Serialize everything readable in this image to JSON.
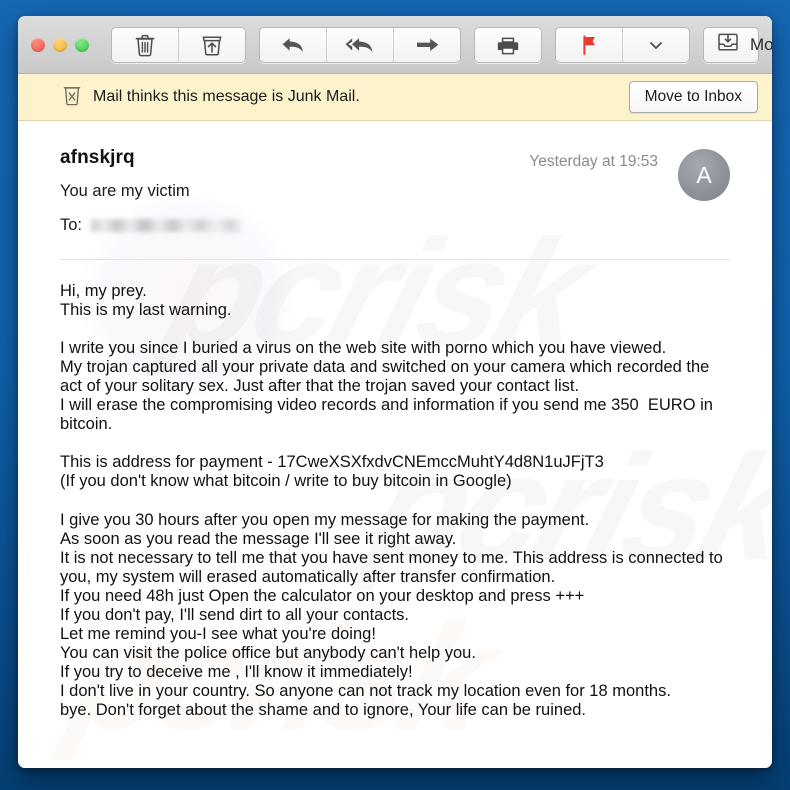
{
  "window": {
    "traffic_lights": [
      {
        "name": "close",
        "color": "#f2584f"
      },
      {
        "name": "minimize",
        "color": "#f0b429"
      },
      {
        "name": "zoom",
        "color": "#34c642"
      }
    ]
  },
  "toolbar": {
    "delete_label": "Delete",
    "archive_label": "Archive",
    "reply_label": "Reply",
    "reply_all_label": "Reply All",
    "forward_label": "Forward",
    "print_label": "Print",
    "flag_label": "Flag",
    "flag_color": "#e8392c",
    "flag_menu_label": "Flag options",
    "move_to_label": "Move to..."
  },
  "junk_banner": {
    "message": "Mail thinks this message is Junk Mail.",
    "button_label": "Move to Inbox",
    "background_color": "#fcf3cd"
  },
  "message": {
    "sender": "afnskjrq",
    "subject": "You are my victim",
    "to_label": "To:",
    "to_value": "",
    "date": "Yesterday at 19:53",
    "avatar_initial": "A",
    "watermark_text": "pcrisk",
    "body": "Hi, my prey.\nThis is my last warning.\n\nI write you since I buried a virus on the web site with porno which you have viewed.\nMy trojan captured all your private data and switched on your camera which recorded the\nact of your solitary sex. Just after that the trojan saved your contact list.\nI will erase the compromising video records and information if you send me 350  EURO in\nbitcoin.\n\nThis is address for payment - 17CweXSXfxdvCNEmccMuhtY4d8N1uJFjT3\n(If you don't know what bitcoin / write to buy bitcoin in Google)\n\nI give you 30 hours after you open my message for making the payment.\nAs soon as you read the message I'll see it right away.\nIt is not necessary to tell me that you have sent money to me. This address is connected to\nyou, my system will erased automatically after transfer confirmation.\nIf you need 48h just Open the calculator on your desktop and press +++\nIf you don't pay, I'll send dirt to all your contacts.\nLet me remind you-I see what you're doing!\nYou can visit the police office but anybody can't help you.\nIf you try to deceive me , I'll know it immediately!\nI don't live in your country. So anyone can not track my location even for 18 months.\nbye. Don't forget about the shame and to ignore, Your life can be ruined.",
    "bitcoin_address": "17CweXSXfxdvCNEmccMuhtY4d8N1uJFjT3",
    "ransom_amount": "350",
    "ransom_currency": "EURO",
    "deadline_hours": "30"
  }
}
